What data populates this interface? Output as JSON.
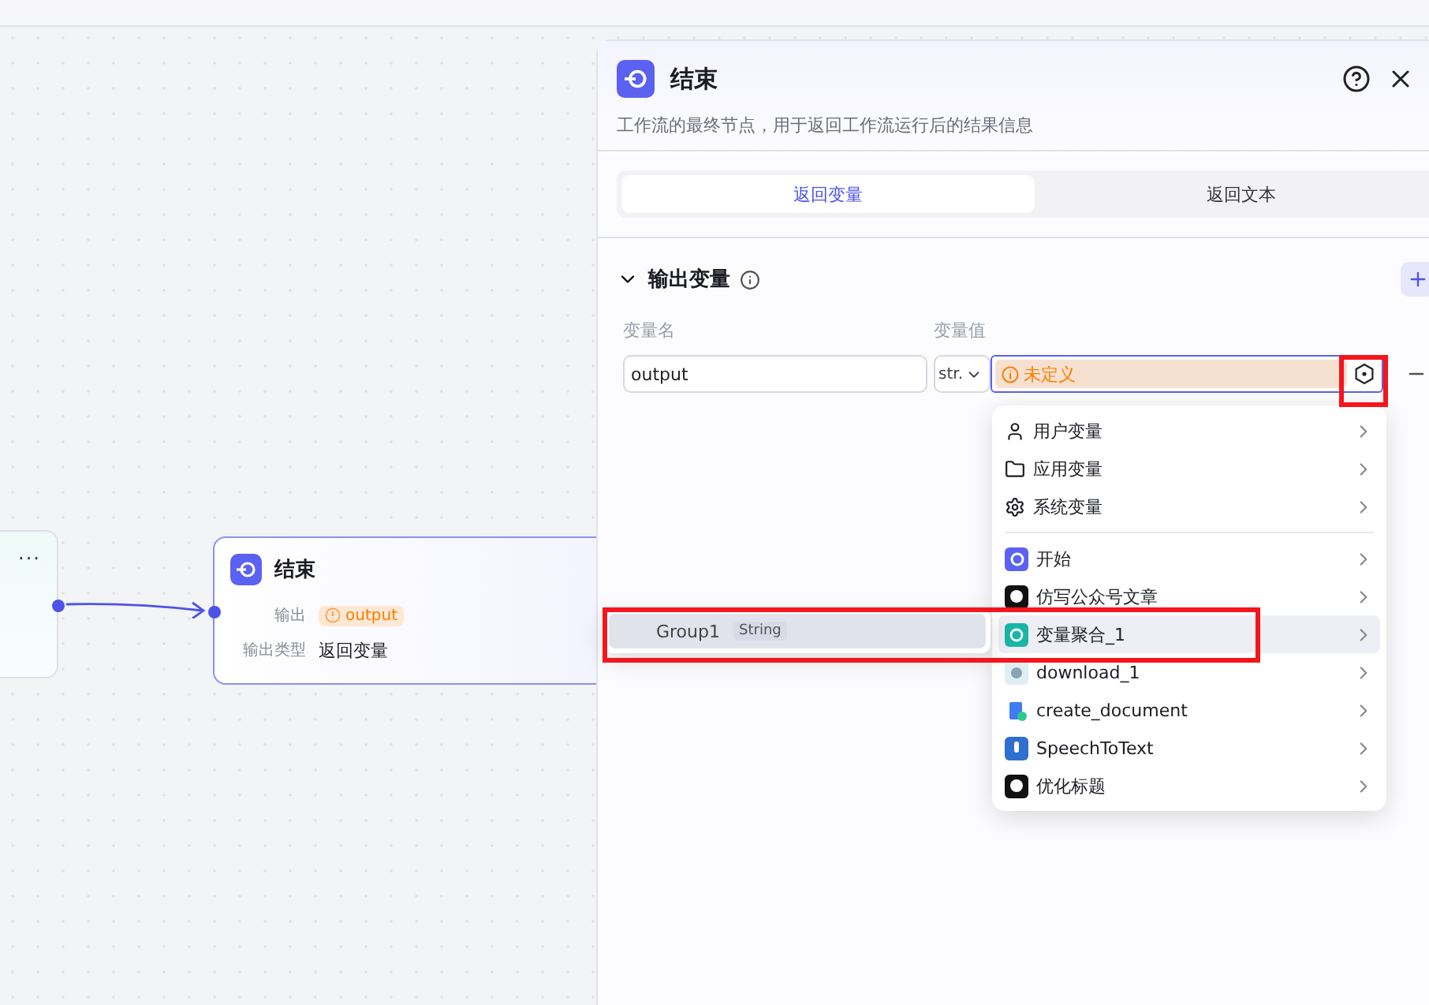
{
  "canvas": {
    "source_node": {
      "menu": "···"
    },
    "end_node": {
      "title": "结束",
      "fields": [
        {
          "label": "输出",
          "value": "output",
          "kind": "warning-tag"
        },
        {
          "label": "输出类型",
          "value": "返回变量",
          "kind": "text"
        }
      ]
    }
  },
  "panel": {
    "title": "结束",
    "description": "工作流的最终节点，用于返回工作流运行后的结果信息",
    "tabs": [
      {
        "label": "返回变量",
        "selected": true
      },
      {
        "label": "返回文本",
        "selected": false
      }
    ],
    "section": {
      "title": "输出变量",
      "expanded": true,
      "columns": [
        "变量名",
        "变量值"
      ],
      "rows": [
        {
          "name": "output",
          "type": "str.",
          "value": "未定义"
        }
      ]
    }
  },
  "menu": {
    "groups": [
      [
        {
          "label": "用户变量",
          "kind": "user",
          "selected": false
        },
        {
          "label": "应用变量",
          "kind": "app",
          "selected": false
        },
        {
          "label": "系统变量",
          "kind": "system",
          "selected": false
        }
      ],
      [
        {
          "label": "开始",
          "kind": "start",
          "selected": false
        },
        {
          "label": "仿写公众号文章",
          "kind": "agent",
          "selected": false
        },
        {
          "label": "变量聚合_1",
          "kind": "aggregate",
          "selected": true
        },
        {
          "label": "download_1",
          "kind": "plugin",
          "selected": false
        },
        {
          "label": "create_document",
          "kind": "document",
          "selected": false
        },
        {
          "label": "SpeechToText",
          "kind": "speech",
          "selected": false
        },
        {
          "label": "优化标题",
          "kind": "agent",
          "selected": false
        }
      ]
    ]
  },
  "submenu": {
    "items": [
      {
        "label": "Group1",
        "type": "String",
        "selected": true
      }
    ]
  }
}
